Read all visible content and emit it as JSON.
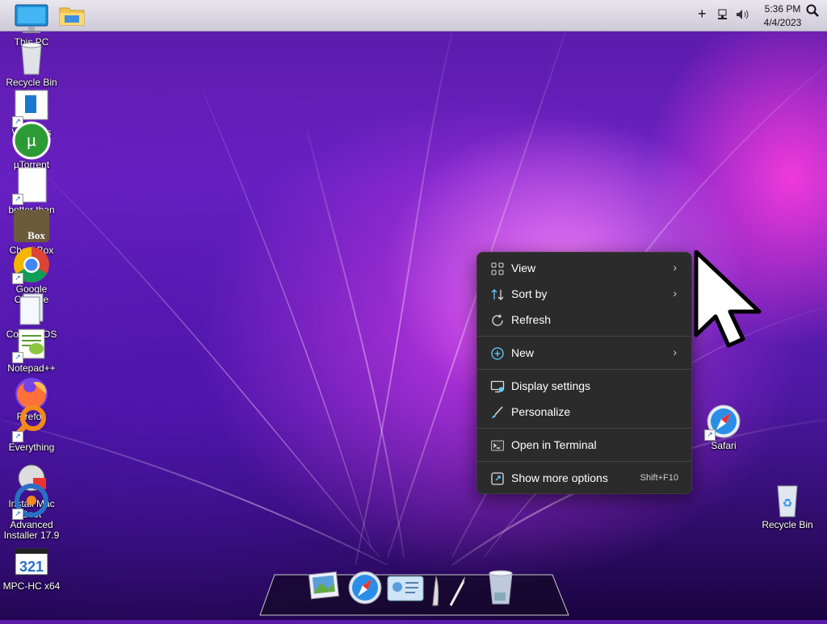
{
  "topbar": {
    "tray": {
      "time": "5:36 PM",
      "date": "4/4/2023"
    }
  },
  "desktop_icons_left": [
    {
      "label": "This PC",
      "icon": "monitor-icon"
    },
    {
      "label": "Recycle Bin",
      "icon": "recycle-bin-icon"
    },
    {
      "label": "Windows Archive",
      "icon": "document-icon"
    },
    {
      "label": "µTorrent",
      "icon": "utorrent-icon"
    },
    {
      "label": "better than chrome",
      "icon": "blank-document-icon"
    },
    {
      "label": "CheckBox",
      "icon": "box-icon"
    },
    {
      "label": "Google Chrome",
      "icon": "chrome-icon"
    },
    {
      "label": "Convert OS",
      "icon": "files-icon"
    },
    {
      "label": "Notepad++",
      "icon": "notepad-plus-plus-icon"
    },
    {
      "label": "Firefox",
      "icon": "firefox-icon"
    },
    {
      "label": "Everything",
      "icon": "search-everything-icon"
    },
    {
      "label": "Install Mac Boot",
      "icon": "installer-icon"
    },
    {
      "label": "Advanced Installer 17.9",
      "icon": "advanced-installer-icon"
    },
    {
      "label": "MPC-HC x64",
      "icon": "mpc-hc-icon"
    }
  ],
  "desktop_icons_right": [
    {
      "label": "Safari",
      "icon": "safari-icon"
    },
    {
      "label": "Recycle Bin",
      "icon": "recycle-bin-icon"
    }
  ],
  "context_menu": {
    "items": [
      {
        "label": "View",
        "icon": "grid-icon",
        "submenu": true
      },
      {
        "label": "Sort by",
        "icon": "sort-icon",
        "submenu": true
      },
      {
        "label": "Refresh",
        "icon": "refresh-icon",
        "submenu": false
      },
      {
        "label": "New",
        "icon": "plus-circle-icon",
        "submenu": true
      },
      {
        "label": "Display settings",
        "icon": "display-icon",
        "submenu": false
      },
      {
        "label": "Personalize",
        "icon": "brush-icon",
        "submenu": false
      },
      {
        "label": "Open in Terminal",
        "icon": "terminal-icon",
        "submenu": false
      },
      {
        "label": "Show more options",
        "icon": "more-options-icon",
        "shortcut": "Shift+F10",
        "submenu": false
      }
    ],
    "submenu_arrow": "›"
  },
  "dock": {
    "items": [
      "photo-viewer-icon",
      "safari-icon",
      "contacts-icon",
      "quill-icon",
      "trash-icon"
    ]
  },
  "colors": {
    "menu_bg": "#2b2b2b",
    "accent": "#60cdff"
  }
}
